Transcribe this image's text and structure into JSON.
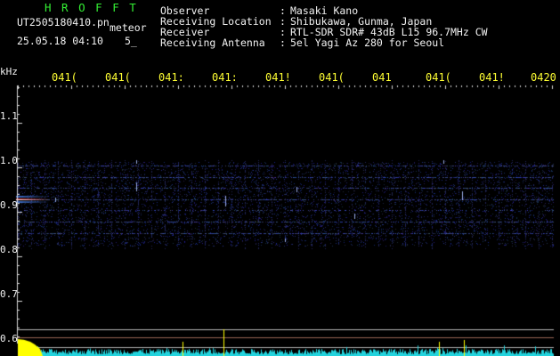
{
  "header": {
    "program_name": "H R O F F T",
    "file_name": "UT2505180410.pn",
    "mode_label": "meteor",
    "datetime": "25.05.18 04:10",
    "count": "5_",
    "info_labels": [
      "Observer",
      "Receiving Location",
      "Receiver",
      "Receiving Antenna"
    ],
    "info_separator": ":",
    "info_values": [
      "Masaki Kano",
      "Shibukawa, Gunma, Japan",
      "RTL-SDR SDR# 43dB L15 96.7MHz CW",
      "5el Yagi Az 280 for Seoul"
    ]
  },
  "axes": {
    "y_unit": "kHz",
    "y_ticks": [
      "1.1",
      "1.0",
      "0.9",
      "0.8",
      "0.7",
      "0.6"
    ],
    "time_ticks": [
      "041(",
      "041(",
      "041:",
      "041:",
      "041!",
      "041(",
      "041",
      "041(",
      "041!",
      "0420"
    ]
  },
  "colors": {
    "background": "#000000",
    "header_green": "#33ee33",
    "header_white": "#f2f2f2",
    "time_labels": "#ffff33",
    "trace": "#22d3dd",
    "echo_yellow": "#ffff00",
    "axis": "#d8d8d8"
  }
}
